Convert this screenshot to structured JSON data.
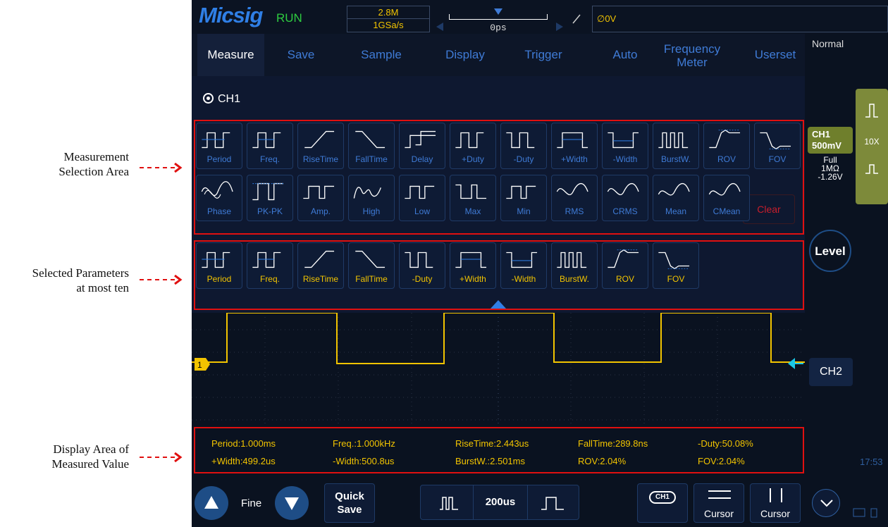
{
  "annotations": {
    "selection": [
      "Measurement",
      "Selection Area"
    ],
    "selected": [
      "Selected Parameters",
      "at most ten"
    ],
    "display": [
      "Display Area of",
      "Measured Value"
    ]
  },
  "header": {
    "logo": "Micsig",
    "status": "RUN",
    "depth": "2.8M",
    "sample_rate": "1GSa/s",
    "delay": "0ps",
    "trigger_level": "∅0V"
  },
  "menu": {
    "tabs": [
      "Measure",
      "Save",
      "Sample",
      "Display",
      "Trigger",
      "Auto",
      "Frequency Meter",
      "Userset"
    ],
    "active": "Measure",
    "mode": "Normal"
  },
  "channel_select": "CH1",
  "params_all": [
    "Period",
    "Freq.",
    "RiseTime",
    "FallTime",
    "Delay",
    "+Duty",
    "-Duty",
    "+Width",
    "-Width",
    "BurstW.",
    "ROV",
    "FOV",
    "Phase",
    "PK-PK",
    "Amp.",
    "High",
    "Low",
    "Max",
    "Min",
    "RMS",
    "CRMS",
    "Mean",
    "CMean"
  ],
  "params_selected": [
    "Period",
    "Freq.",
    "RiseTime",
    "FallTime",
    "-Duty",
    "+Width",
    "-Width",
    "BurstW.",
    "ROV",
    "FOV"
  ],
  "clear_label": "Clear",
  "measurements": {
    "row1": [
      "Period:1.000ms",
      "Freq.:1.000kHz",
      "RiseTime:2.443us",
      "FallTime:289.8ns",
      "-Duty:50.08%"
    ],
    "row2": [
      "+Width:499.2us",
      "-Width:500.8us",
      "BurstW.:2.501ms",
      "ROV:2.04%",
      "FOV:2.04%"
    ]
  },
  "channel_info": {
    "name": "CH1",
    "scale": "500mV",
    "bandwidth": "Full",
    "impedance": "1MΩ",
    "offset": "-1.26V",
    "probe": "10X"
  },
  "level_label": "Level",
  "ch2_label": "CH2",
  "bottom": {
    "fine": "Fine",
    "quick_save": [
      "Quick",
      "Save"
    ],
    "timebase": "200us",
    "cursor1": "Cursor",
    "cursor2": "Cursor",
    "ch1_chip": "CH1",
    "time": "17:53"
  },
  "colors": {
    "accent": "#3f7bd6",
    "trace": "#f2c400",
    "highlight": "#e01010"
  }
}
